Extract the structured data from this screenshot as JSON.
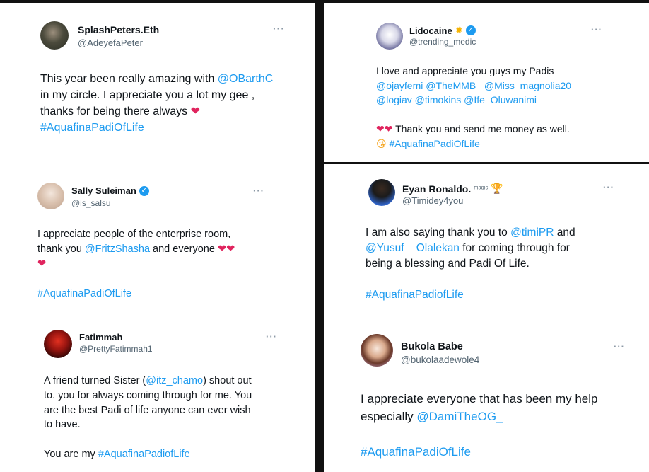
{
  "tweets": [
    {
      "name": "SplashPeters.Eth",
      "handle": "@AdeyefaPeter",
      "more": "···",
      "line1_a": "This year been really amazing with ",
      "line1_link": "@OBarthC",
      "line2": "in my circle. I appreciate you a lot my gee ,",
      "line3": "thanks for being there always ",
      "hashtag": "#AquafinaPadiOfLife"
    },
    {
      "name": "Lidocaine",
      "handle": "@trending_medic",
      "more": "···",
      "line1": "I love and appreciate you guys my Padis",
      "line2": "@ojayfemi @TheMMB_ @Miss_magnolia20",
      "line3": "@logiav @timokins @Ife_Oluwanimi",
      "line4": " Thank you and send me money as well.",
      "hashtag": "#AquafinaPadiOfLife"
    },
    {
      "name": "Sally Suleiman",
      "handle": "@is_salsu",
      "more": "···",
      "line1": "I appreciate people of the enterprise room,",
      "line2_a": "thank you ",
      "line2_link": "@FritzShasha",
      "line2_b": " and everyone ",
      "hashtag": "#AquafinaPadiOfLife"
    },
    {
      "name": "Eyan Ronaldo.",
      "name_suffix": "ᵐᵃᵍᶦᶜ",
      "handle": "@Timidey4you",
      "more": "···",
      "line1_a": "I am also saying thank you to  ",
      "line1_link": "@timiPR",
      "line1_b": " and",
      "line2_link": "@Yusuf__Olalekan",
      "line2_b": " for coming through for",
      "line3": "being a blessing and Padi Of Life.",
      "hashtag": "#AquafinaPadiofLife"
    },
    {
      "name": "Fatimmah",
      "handle": "@PrettyFatimmah1",
      "more": "···",
      "line1_a": "A friend turned Sister (",
      "line1_link": "@itz_chamo",
      "line1_b": ") shout out",
      "line2": "to. you for always coming through for me. You",
      "line3": "are the best Padi of life anyone can ever wish",
      "line4": "to have.",
      "line5_a": "You are my ",
      "hashtag": "#AquafinaPadiofLife"
    },
    {
      "name": "Bukola Babe",
      "handle": "@bukolaadewole4",
      "more": "···",
      "line1": "I appreciate everyone that has been my help",
      "line2_a": "especially ",
      "line2_link": "@DamiTheOG_",
      "hashtag": "#AquafinaPadiOfLife"
    }
  ],
  "colors": {
    "link": "#1d9bf0",
    "text": "#0f1419",
    "muted": "#536471",
    "heart": "#e0245e",
    "divider": "#111111"
  },
  "icons": [
    "verified-badge-icon",
    "more-options-icon",
    "heart-emoji-icon",
    "sparkle-emoji-icon",
    "trophy-emoji-icon",
    "winking-kiss-emoji-icon"
  ]
}
